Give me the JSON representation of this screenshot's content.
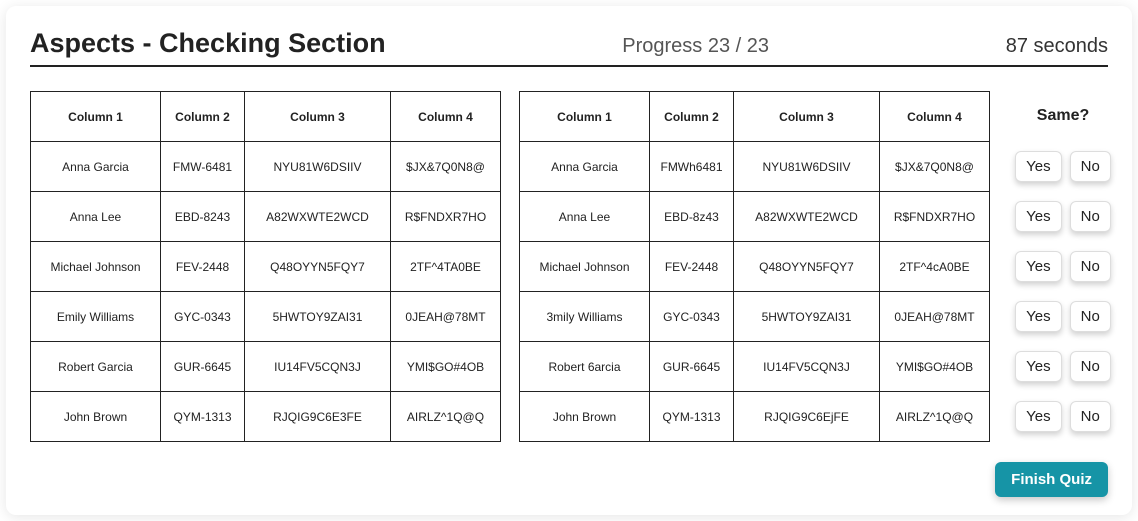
{
  "header": {
    "title": "Aspects - Checking Section",
    "progress_text": "Progress 23 / 23",
    "timer_text": "87 seconds"
  },
  "columns": [
    "Column 1",
    "Column 2",
    "Column 3",
    "Column 4"
  ],
  "left_rows": [
    [
      "Anna Garcia",
      "FMW-6481",
      "NYU81W6DSIIV",
      "$JX&7Q0N8@"
    ],
    [
      "Anna Lee",
      "EBD-8243",
      "A82WXWTE2WCD",
      "R$FNDXR7HO"
    ],
    [
      "Michael Johnson",
      "FEV-2448",
      "Q48OYYN5FQY7",
      "2TF^4TA0BE"
    ],
    [
      "Emily Williams",
      "GYC-0343",
      "5HWTOY9ZAI31",
      "0JEAH@78MT"
    ],
    [
      "Robert Garcia",
      "GUR-6645",
      "IU14FV5CQN3J",
      "YMI$GO#4OB"
    ],
    [
      "John Brown",
      "QYM-1313",
      "RJQIG9C6E3FE",
      "AIRLZ^1Q@Q"
    ]
  ],
  "right_rows": [
    [
      "Anna Garcia",
      "FMWh6481",
      "NYU81W6DSIIV",
      "$JX&7Q0N8@"
    ],
    [
      "Anna Lee",
      "EBD-8z43",
      "A82WXWTE2WCD",
      "R$FNDXR7HO"
    ],
    [
      "Michael Johnson",
      "FEV-2448",
      "Q48OYYN5FQY7",
      "2TF^4cA0BE"
    ],
    [
      "3mily Williams",
      "GYC-0343",
      "5HWTOY9ZAI31",
      "0JEAH@78MT"
    ],
    [
      "Robert 6arcia",
      "GUR-6645",
      "IU14FV5CQN3J",
      "YMI$GO#4OB"
    ],
    [
      "John Brown",
      "QYM-1313",
      "RJQIG9C6EjFE",
      "AIRLZ^1Q@Q"
    ]
  ],
  "answers": {
    "title": "Same?",
    "yes_label": "Yes",
    "no_label": "No",
    "row_count": 6
  },
  "footer": {
    "finish_label": "Finish Quiz"
  }
}
